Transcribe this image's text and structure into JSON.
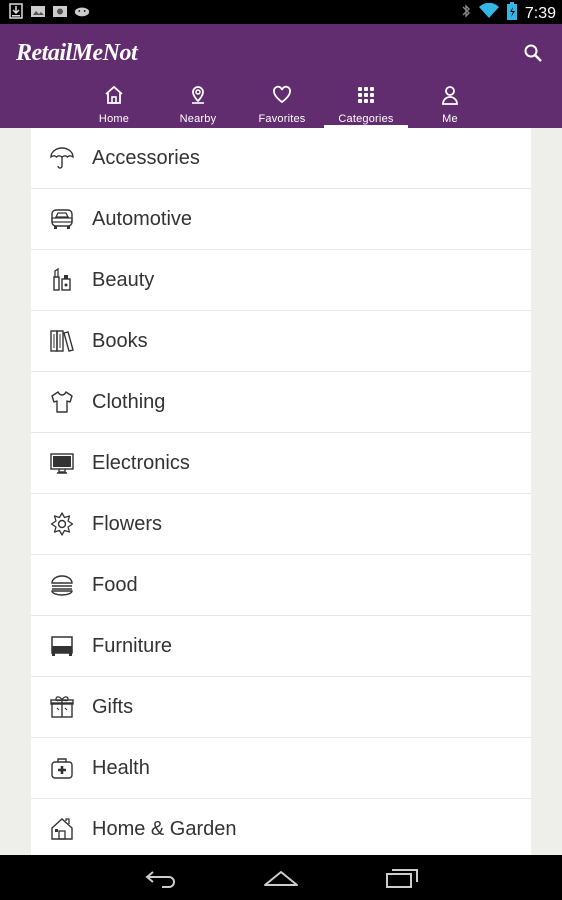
{
  "status_bar": {
    "time": "7:39",
    "icons": [
      "download-icon",
      "photo-icon",
      "photo-icon",
      "android-icon",
      "bluetooth-icon",
      "wifi-icon",
      "battery-icon"
    ]
  },
  "app_bar": {
    "logo_text": "RetailMeNot",
    "search_icon": "search-icon",
    "background": "#622d6e"
  },
  "tabs": [
    {
      "label": "Home",
      "icon": "home-icon",
      "active": false
    },
    {
      "label": "Nearby",
      "icon": "map-pin-icon",
      "active": false
    },
    {
      "label": "Favorites",
      "icon": "heart-icon",
      "active": false
    },
    {
      "label": "Categories",
      "icon": "grid-icon",
      "active": true
    },
    {
      "label": "Me",
      "icon": "person-icon",
      "active": false
    }
  ],
  "categories": [
    {
      "label": "Accessories",
      "icon": "umbrella-icon"
    },
    {
      "label": "Automotive",
      "icon": "car-icon"
    },
    {
      "label": "Beauty",
      "icon": "lipstick-icon"
    },
    {
      "label": "Books",
      "icon": "books-icon"
    },
    {
      "label": "Clothing",
      "icon": "shirt-icon"
    },
    {
      "label": "Electronics",
      "icon": "monitor-icon"
    },
    {
      "label": "Flowers",
      "icon": "flower-icon"
    },
    {
      "label": "Food",
      "icon": "burger-icon"
    },
    {
      "label": "Furniture",
      "icon": "furniture-icon"
    },
    {
      "label": "Gifts",
      "icon": "gift-icon"
    },
    {
      "label": "Health",
      "icon": "first-aid-icon"
    },
    {
      "label": "Home & Garden",
      "icon": "house-icon"
    }
  ],
  "nav_bar": {
    "buttons": [
      "back-icon",
      "home-icon",
      "recents-icon"
    ]
  }
}
